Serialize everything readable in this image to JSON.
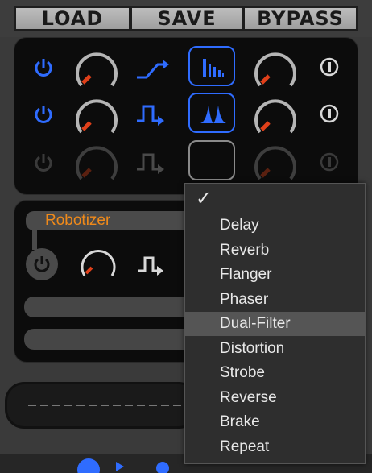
{
  "toolbar": {
    "load_label": "LOAD",
    "save_label": "SAVE",
    "bypass_label": "BYPASS"
  },
  "slots": [
    {
      "power": "on",
      "mode_icon": "bars-icon"
    },
    {
      "power": "on",
      "mode_icon": "peaks-icon"
    },
    {
      "power": "off",
      "mode_icon": "empty"
    }
  ],
  "effect": {
    "name": "Robotizer"
  },
  "dropdown": {
    "selected_marker": "✓",
    "items": [
      "Delay",
      "Reverb",
      "Flanger",
      "Phaser",
      "Dual-Filter",
      "Distortion",
      "Strobe",
      "Reverse",
      "Brake",
      "Repeat"
    ],
    "highlighted": "Dual-Filter"
  },
  "colors": {
    "accent_blue": "#2f6cff",
    "knob_indicator": "#e0401a",
    "effect_name": "#f08a1a"
  }
}
